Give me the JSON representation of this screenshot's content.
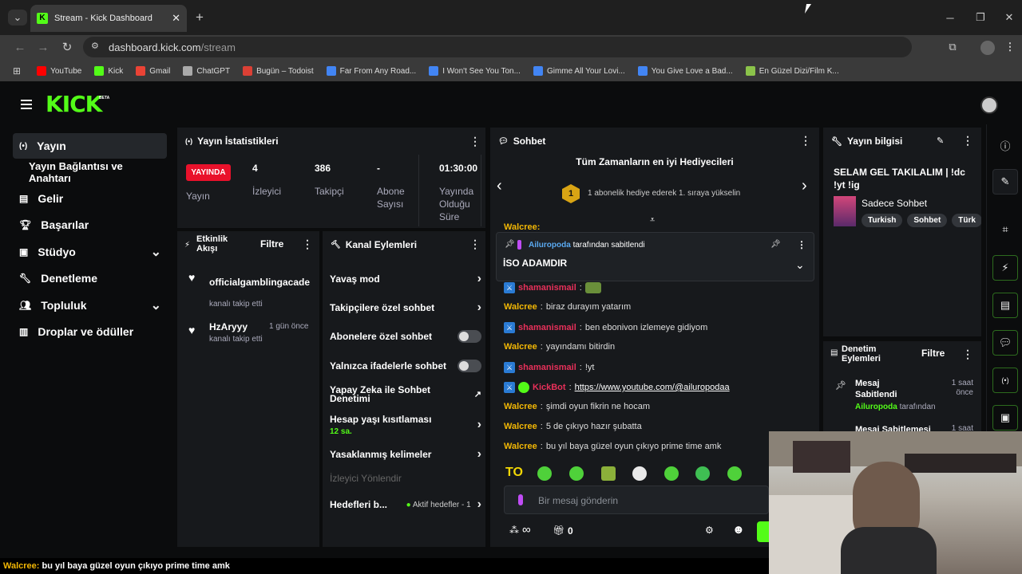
{
  "browser": {
    "tab_title": "Stream - Kick Dashboard",
    "url_domain": "dashboard.kick.com",
    "url_path": "/stream",
    "bookmarks": [
      {
        "label": "YouTube",
        "color": "#ff0000"
      },
      {
        "label": "Kick",
        "color": "#53fc18"
      },
      {
        "label": "Gmail",
        "color": "#ea4335"
      },
      {
        "label": "ChatGPT",
        "color": "#aaaaaa"
      },
      {
        "label": "Bugün – Todoist",
        "color": "#db4035"
      },
      {
        "label": "Far From Any Road...",
        "color": "#4285f4"
      },
      {
        "label": "I Won't See You Ton...",
        "color": "#4285f4"
      },
      {
        "label": "Gimme All Your Lovi...",
        "color": "#4285f4"
      },
      {
        "label": "You Give Love a Bad...",
        "color": "#4285f4"
      },
      {
        "label": "En Güzel Dizi/Film K...",
        "color": "#8bc34a"
      }
    ]
  },
  "brand": {
    "logo": "KICK",
    "beta": "BETA",
    "accent": "#53fc18"
  },
  "nav": [
    {
      "label": "Yayın"
    },
    {
      "label": "Yayın Bağlantısı ve Anahtarı"
    },
    {
      "label": "Gelir"
    },
    {
      "label": "Başarılar"
    },
    {
      "label": "Stüdyo"
    },
    {
      "label": "Denetleme"
    },
    {
      "label": "Topluluk"
    },
    {
      "label": "Droplar ve ödüller"
    }
  ],
  "stats": {
    "title": "Yayın İstatistikleri",
    "live_badge": "YAYINDA",
    "live_label": "Yayın",
    "viewers": "4",
    "viewers_label": "İzleyici",
    "followers": "386",
    "followers_label": "Takipçi",
    "subs": "-",
    "subs_label": "Abone Sayısı",
    "uptime": "01:30:00",
    "uptime_label": "Yayında Olduğu Süre"
  },
  "activity": {
    "title": "Etkinlik Akışı",
    "filter": "Filtre",
    "items": [
      {
        "user": "officialgamblingacade",
        "action": "kanalı takip etti",
        "time": ""
      },
      {
        "user": "HzAryyy",
        "action": "kanalı takip etti",
        "time": "1 gün önce"
      }
    ]
  },
  "channel_actions": {
    "title": "Kanal Eylemleri",
    "slow": "Yavaş mod",
    "followers_only": "Takipçilere özel sohbet",
    "subs_only": "Abonelere özel sohbet",
    "emotes_only": "Yalnızca ifadelerle sohbet",
    "ai_moderation": "Yapay Zeka ile Sohbet Denetimi",
    "age": "Hesap yaşı kısıtlaması",
    "age_value": "12 sa.",
    "banned": "Yasaklanmış kelimeler",
    "redirect": "İzleyici Yönlendir",
    "goals": "Hedefleri b...",
    "goals_status": "Aktif hedefler - 1"
  },
  "chat": {
    "title": "Sohbet",
    "gifters_title": "Tüm Zamanların en iyi Hediyecileri",
    "gifters_rank": "1",
    "gifters_text": "1 abonelik hediye ederek 1. sıraya yükselin",
    "partial_user": "Walcree:",
    "pinned_by": "Ailuropoda",
    "pinned_suffix": "tarafından sabitlendi",
    "pinned_message": "İSO ADAMDIR",
    "messages": [
      {
        "user": "shamanismail",
        "text": ""
      },
      {
        "user": "Walcree",
        "text": "biraz durayım yatarım"
      },
      {
        "user": "shamanismail",
        "text": "ben ebonivon izlemeye gidiyom"
      },
      {
        "user": "Walcree",
        "text": "yayındamı bitirdin"
      },
      {
        "user": "shamanismail",
        "text": "!yt"
      },
      {
        "user": "KickBot",
        "text": "https://www.youtube.com/@ailuropodaa"
      },
      {
        "user": "Walcree",
        "text": "şimdi oyun fikrin ne hocam"
      },
      {
        "user": "Walcree",
        "text": "5 de çıkıyo hazır şubatta"
      },
      {
        "user": "Walcree",
        "text": "bu yıl baya güzel oyun çıkıyo prime time amk"
      }
    ],
    "emote_text": "TO",
    "input_placeholder": "Bir mesaj gönderin",
    "infinity": "∞",
    "gift_count": "0"
  },
  "stream_info": {
    "title": "Yayın bilgisi",
    "stream_title": "SELAM GEL TAKILALIM | !dc !yt !ig",
    "category": "Sadece Sohbet",
    "tags": [
      "Turkish",
      "Sohbet",
      "Türk"
    ]
  },
  "mod_actions": {
    "title": "Denetim Eylemleri",
    "filter": "Filtre",
    "items": [
      {
        "action": "Mesaj Sabitlendi",
        "by": "Ailuropoda",
        "by_suffix": "tarafından",
        "time": "1 saat önce"
      },
      {
        "action": "Mesaj Sabitlemesi",
        "time": "1 saat"
      }
    ]
  },
  "overlay_caption": {
    "user": "Walcree:",
    "text": "bu yıl baya güzel oyun çıkıyo prime time amk"
  }
}
